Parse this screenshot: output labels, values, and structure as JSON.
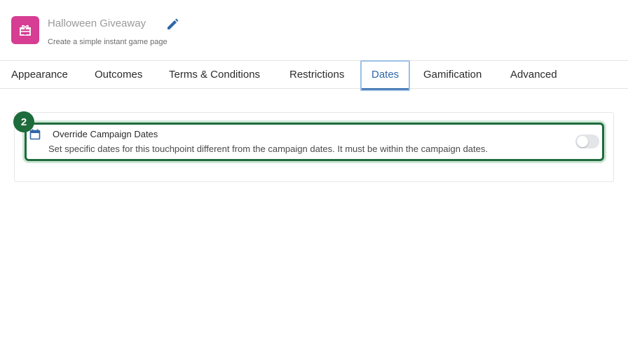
{
  "header": {
    "title": "Halloween Giveaway",
    "subtitle": "Create a simple instant game page",
    "app_icon": "gift-icon",
    "edit_icon": "pencil-icon",
    "brand_color": "#d63d93"
  },
  "tabs": [
    {
      "label": "Appearance",
      "active": false
    },
    {
      "label": "Outcomes",
      "active": false
    },
    {
      "label": "Terms & Conditions",
      "active": false
    },
    {
      "label": "Restrictions",
      "active": false
    },
    {
      "label": "Dates",
      "active": true
    },
    {
      "label": "Gamification",
      "active": false
    },
    {
      "label": "Advanced",
      "active": false
    }
  ],
  "dates": {
    "step_number": "2",
    "icon": "calendar-icon",
    "title": "Override Campaign Dates",
    "description": "Set specific dates for this touchpoint different from the campaign dates. It must be within the campaign dates.",
    "toggle_on": false,
    "highlight_color": "#1e6b3c"
  }
}
